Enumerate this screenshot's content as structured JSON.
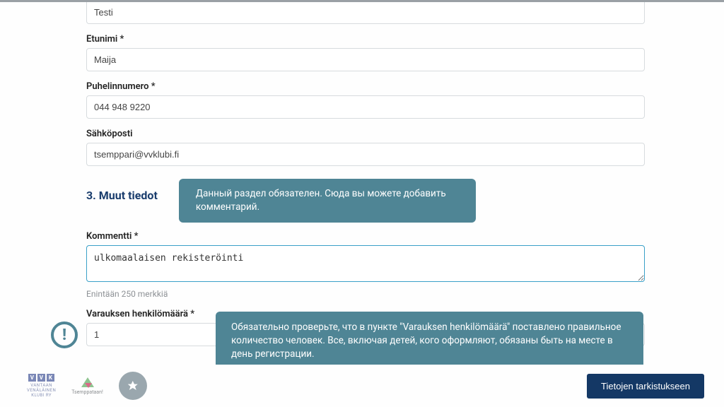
{
  "fields": {
    "lastname_value": "Testi",
    "firstname_label": "Etunimi *",
    "firstname_value": "Maija",
    "phone_label": "Puhelinnumero *",
    "phone_value": "044 948 9220",
    "email_label": "Sähköposti",
    "email_value": "tsemppari@vvklubi.fi",
    "comment_label": "Kommentti *",
    "comment_value": "ulkomaalaisen rekisteröinti",
    "comment_helper": "Enintään 250 merkkiä",
    "count_label": "Varauksen henkilömäärä *",
    "count_value": "1"
  },
  "section": {
    "other_info_title": "3. Muut tiedot"
  },
  "callouts": {
    "section_hint": "Данный раздел обязателен. Сюда вы можете добавить  комментарий.",
    "count_hint": "Обязательно проверьте, что в пункте \"Varauksen henkilömäärä\" поставлено правильное количество человек. Все, включая детей, кого оформляют, обязаны быть на месте в день регистрации."
  },
  "footer": {
    "vvk_caption_1": "VANTAAN",
    "vvk_caption_2": "VENÄLÄINEN",
    "vvk_caption_3": "KLUBI RY",
    "tsem_caption": "Tsemppataan!",
    "submit_label": "Tietojen tarkistukseen"
  },
  "info_badge_glyph": "!"
}
